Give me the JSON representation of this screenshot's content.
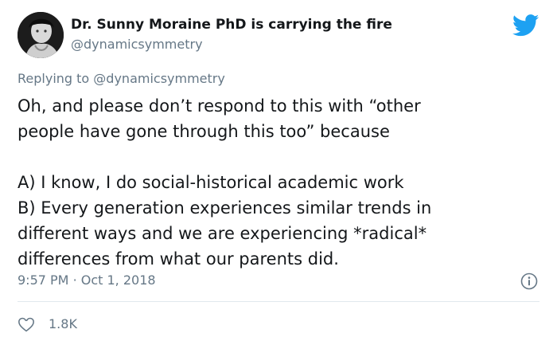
{
  "author": {
    "display_name": "Dr. Sunny Moraine PhD is carrying the fire",
    "handle": "@dynamicsymmetry"
  },
  "reply": {
    "prefix": "Replying to",
    "handle": "@dynamicsymmetry"
  },
  "tweet": {
    "lines": [
      "Oh, and please don’t respond to this with “other",
      "people have gone through this too” because",
      "",
      "A) I know, I do social-historical academic work",
      "B) Every generation experiences similar trends in",
      "different ways and we are experiencing *radical*",
      "differences from what our parents did."
    ],
    "time": "9:57 PM",
    "separator": "·",
    "date": "Oct 1, 2018"
  },
  "likes": {
    "count": "1.8K"
  },
  "icons": {
    "brand": "twitter-bird-icon",
    "info": "info-icon",
    "like": "heart-outline-icon"
  },
  "colors": {
    "brand_blue": "#1da1f2",
    "text_primary": "#14171a",
    "text_secondary": "#657786",
    "divider": "#e1e8ed"
  }
}
